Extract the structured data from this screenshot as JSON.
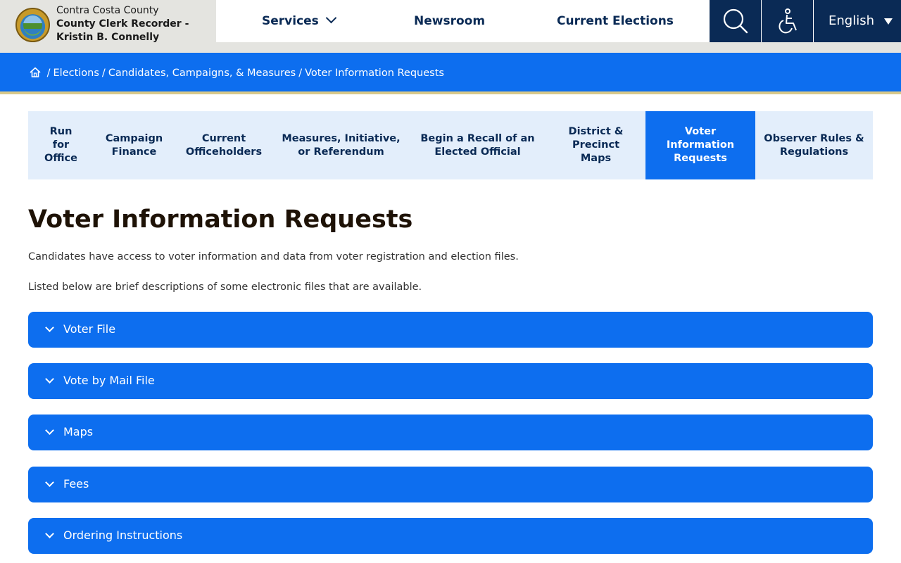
{
  "brand": {
    "line1": "Contra Costa County",
    "line2": "County Clerk Recorder -",
    "line3": "Kristin B. Connelly",
    "seal_icon": "county-seal-logo"
  },
  "topnav": {
    "services": "Services",
    "newsroom": "Newsroom",
    "current_elections": "Current Elections"
  },
  "utility": {
    "search_icon": "search-icon",
    "accessibility_icon": "accessibility-icon",
    "language": "English"
  },
  "breadcrumb": {
    "home_icon": "home-icon",
    "items": [
      "Elections",
      "Candidates, Campaigns, & Measures",
      "Voter Information Requests"
    ]
  },
  "tabs": [
    {
      "label": "Run\nfor\nOffice",
      "active": false
    },
    {
      "label": "Campaign\nFinance",
      "active": false
    },
    {
      "label": "Current\nOfficeholders",
      "active": false
    },
    {
      "label": "Measures, Initiative,\nor Referendum",
      "active": false
    },
    {
      "label": "Begin a Recall of an\nElected Official",
      "active": false
    },
    {
      "label": "District &\nPrecinct\nMaps",
      "active": false
    },
    {
      "label": "Voter\nInformation\nRequests",
      "active": true
    },
    {
      "label": "Observer Rules &\nRegulations",
      "active": false
    }
  ],
  "page": {
    "title": "Voter Information Requests",
    "intro1": "Candidates have access to voter information and data from voter registration and election files.",
    "intro2": "Listed below are brief descriptions of some electronic files that are available."
  },
  "accordion": [
    {
      "label": "Voter File"
    },
    {
      "label": "Vote by Mail File"
    },
    {
      "label": "Maps"
    },
    {
      "label": "Fees"
    },
    {
      "label": "Ordering Instructions"
    }
  ],
  "colors": {
    "primary_blue": "#0d6eef",
    "navy": "#0a2a55",
    "tab_bg": "#e3eefb",
    "gold_rule": "#d9c98a"
  }
}
